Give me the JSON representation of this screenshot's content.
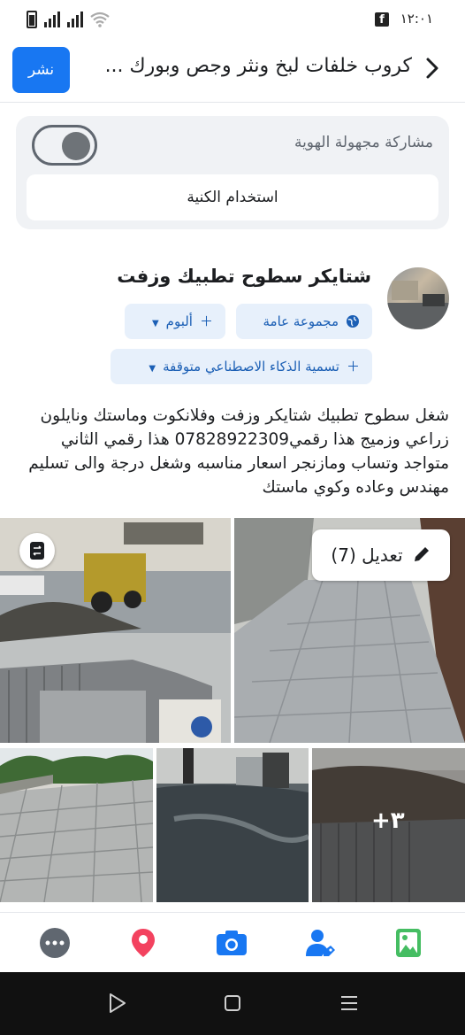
{
  "status_bar": {
    "time": "١٢:٠١",
    "app_icon": "facebook-icon"
  },
  "header": {
    "title": "كروب خلفات لبخ ونثر وجص وبورك ...",
    "post_button": "نشر",
    "back_icon": "chevron-right-icon"
  },
  "anonymous": {
    "label": "مشاركة مجهولة الهوية",
    "toggle_on": false,
    "alias_button": "استخدام الكنية"
  },
  "author": {
    "name": "شتايكر سطوح تطبيك وزفت",
    "chips": {
      "audience": "مجموعة عامة",
      "album": "ألبوم",
      "ai_label": "تسمية الذكاء الاصطناعي متوقفة"
    }
  },
  "post": {
    "text": "شغل سطوح تطبيك شتايكر وزفت وفلانكوت وماستك ونايلون زراعي وزميج هذا رقمي07828922309 هذا رقمي الثاني متواجد وتساب ومازنجر اسعار مناسبه وشغل درجة والى تسليم مهندس وعاده وكوي ماستك"
  },
  "photos": {
    "edit_button": "تعديل (7)",
    "more_count": "+٣"
  },
  "toolbar": {
    "icons": [
      "more-icon",
      "location-icon",
      "camera-icon",
      "tag-people-icon",
      "photo-icon"
    ],
    "colors": {
      "more": "#606770",
      "location": "#f3425f",
      "camera": "#1877f2",
      "tag": "#1877f2",
      "photo": "#45bd62"
    }
  },
  "colors": {
    "accent": "#1877f2",
    "chip_bg": "#e7f0fb",
    "chip_text": "#1b5fb5"
  }
}
